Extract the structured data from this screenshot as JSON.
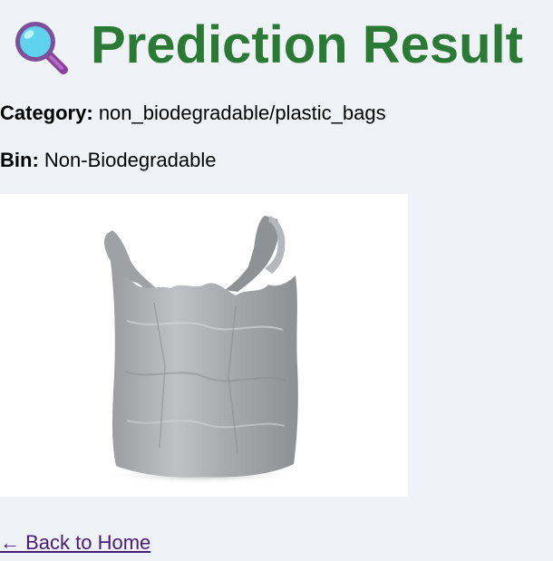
{
  "header": {
    "icon": "magnifying-glass-icon",
    "title": "Prediction Result"
  },
  "result": {
    "category_label": "Category:",
    "category_value": "non_biodegradable/plastic_bags",
    "bin_label": "Bin:",
    "bin_value": "Non-Biodegradable"
  },
  "image": {
    "subject": "plastic-bag-image"
  },
  "nav": {
    "back_label": "← Back to Home"
  },
  "colors": {
    "background": "#eff2f7",
    "title": "#2a7a35",
    "link": "#4a1c7a"
  }
}
